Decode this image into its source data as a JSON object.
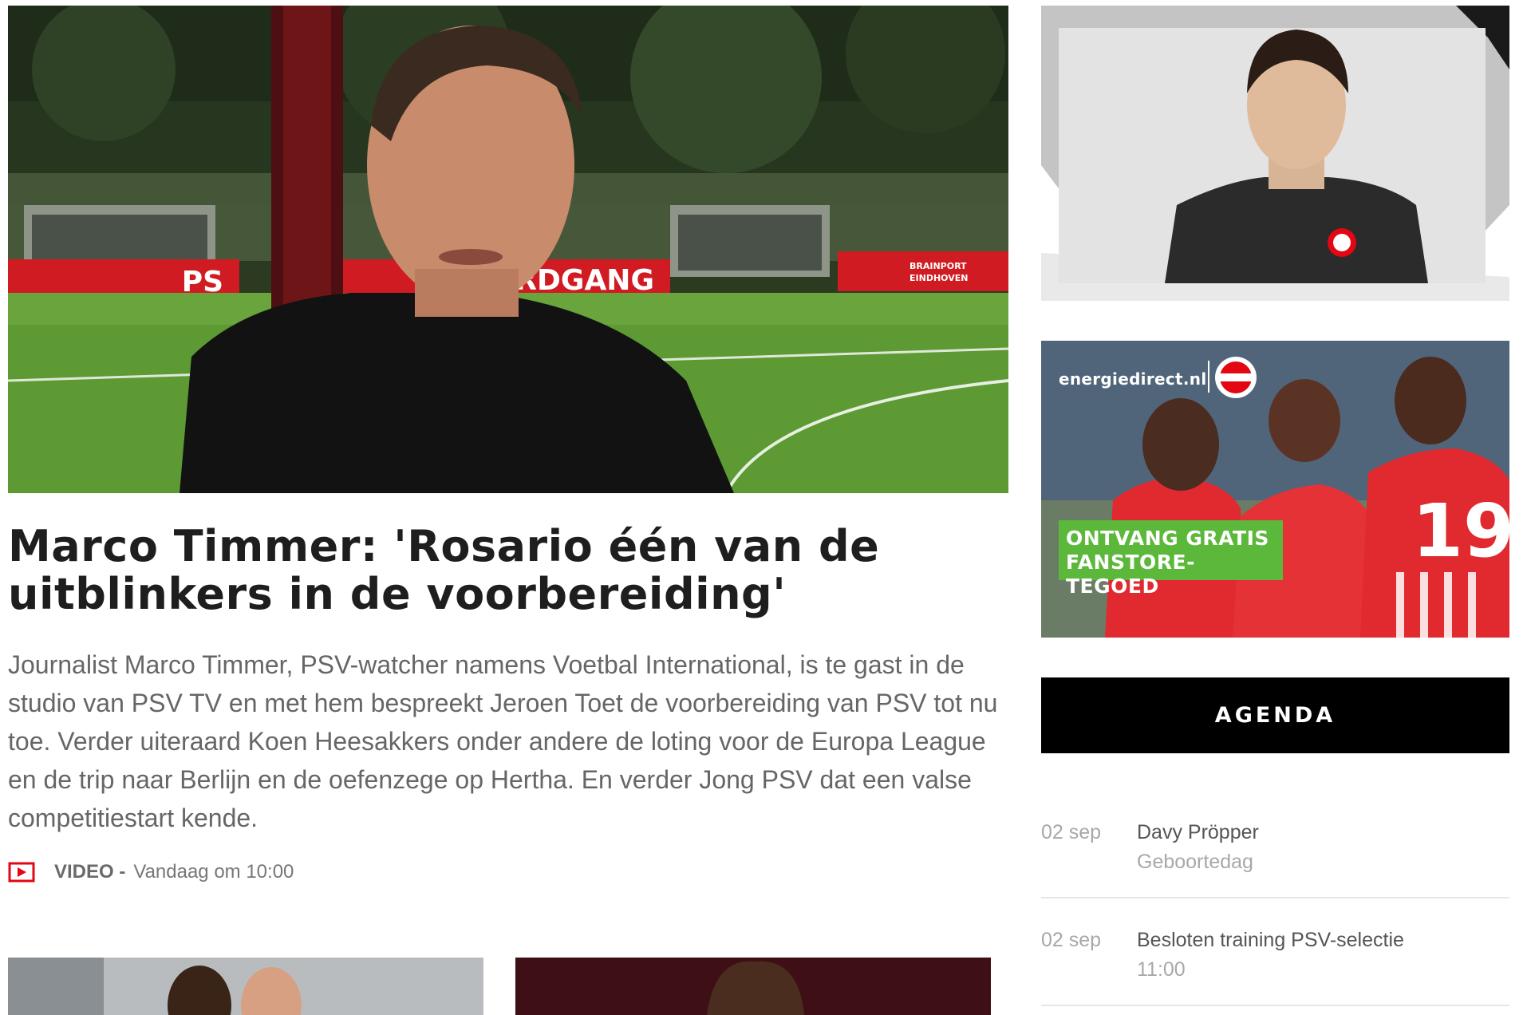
{
  "featured": {
    "headline": "Marco Timmer: 'Rosario één van de uitblinkers in de voorbereiding'",
    "summary": "Journalist Marco Timmer, PSV-watcher namens Voetbal International, is te gast in de studio van PSV TV en met hem bespreekt Jeroen Toet de voorbereiding van PSV tot nu toe. Verder uiteraard Koen Heesakkers onder andere de loting voor de Europa League en de trip naar Berlijn en de oefenzege op Hertha. En verder Jong PSV dat een valse competitiestart kende.",
    "type_label": "VIDEO -",
    "time_label": "Vandaag om 10:00",
    "image_signage": {
      "sign_left": "PS",
      "sign_mid": "RDGANG",
      "sign_right_line1": "BRAINPORT",
      "sign_right_line2": "EINDHOVEN"
    }
  },
  "sidebar": {
    "ad": {
      "logo": "energiedirect.nl",
      "cta_line1": "ONTVANG GRATIS",
      "cta_line2": "FANSTORE-TEGOED",
      "jersey_number": "19"
    },
    "agenda": {
      "header": "AGENDA",
      "items": [
        {
          "date": "02 sep",
          "title": "Davy Pröpper",
          "subtitle": "Geboortedag"
        },
        {
          "date": "02 sep",
          "title": "Besloten training PSV-selectie",
          "subtitle": "11:00"
        }
      ]
    }
  },
  "colors": {
    "psv_red": "#e30613",
    "ad_green": "#5cb83a",
    "text_dark": "#1e1e1e",
    "text_grey": "#666666"
  },
  "icons": {
    "video": "play-icon"
  }
}
